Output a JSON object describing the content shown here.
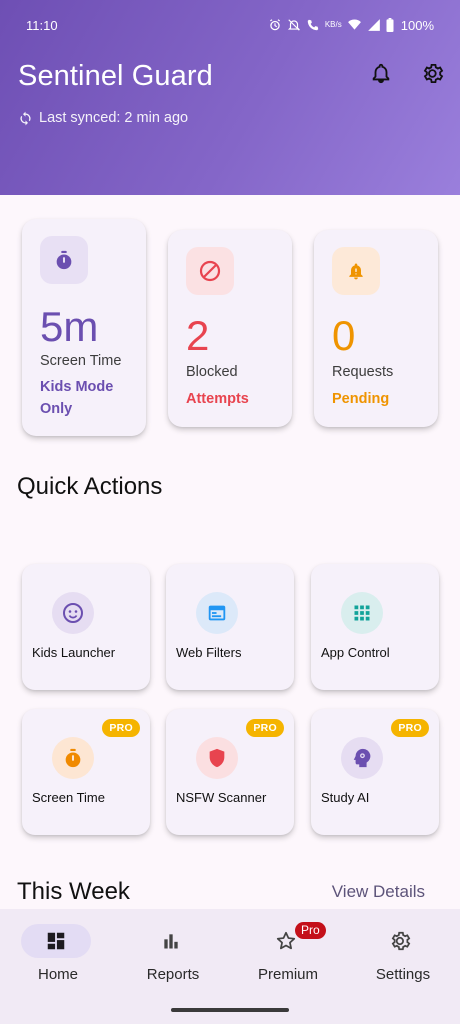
{
  "status_bar": {
    "time": "11:10",
    "battery": "100%"
  },
  "header": {
    "title": "Sentinel Guard",
    "sync_text": "Last synced: 2 min ago"
  },
  "stats": [
    {
      "value": "5m",
      "label": "Screen Time",
      "sub": "Kids Mode Only",
      "icon": "timer-icon",
      "color": "#6b4fb0",
      "icon_bg": "#e8e0f4"
    },
    {
      "value": "2",
      "label": "Blocked",
      "sub": "Attempts",
      "icon": "block-icon",
      "color": "#e8444f",
      "icon_bg": "#fbe1e3"
    },
    {
      "value": "0",
      "label": "Requests",
      "sub": "Pending",
      "icon": "alarm-bell-icon",
      "color": "#ef9400",
      "icon_bg": "#fde9d8"
    }
  ],
  "quick_actions": {
    "title": "Quick Actions",
    "items": [
      {
        "label": "Kids Launcher",
        "icon": "child-face-icon",
        "pro": false,
        "color": "#6b4fb0",
        "icon_bg": "#e6ddf2"
      },
      {
        "label": "Web Filters",
        "icon": "browser-window-icon",
        "pro": false,
        "color": "#2196f3",
        "icon_bg": "#dce9f9"
      },
      {
        "label": "App Control",
        "icon": "apps-grid-icon",
        "pro": false,
        "color": "#12a39a",
        "icon_bg": "#d9eeee"
      },
      {
        "label": "Screen Time",
        "icon": "timer-icon",
        "pro": true,
        "color": "#f08a00",
        "icon_bg": "#fde6d3"
      },
      {
        "label": "NSFW Scanner",
        "icon": "shield-icon",
        "pro": true,
        "color": "#e8444f",
        "icon_bg": "#fbdfe1"
      },
      {
        "label": "Study AI",
        "icon": "brain-head-icon",
        "pro": true,
        "color": "#6b4fb0",
        "icon_bg": "#e6ddf2"
      }
    ],
    "pro_label": "PRO"
  },
  "this_week": {
    "title": "This Week",
    "link": "View Details"
  },
  "bottom_nav": [
    {
      "label": "Home",
      "icon": "dashboard-icon",
      "active": true
    },
    {
      "label": "Reports",
      "icon": "bar-chart-icon",
      "active": false
    },
    {
      "label": "Premium",
      "icon": "star-icon",
      "active": false,
      "badge": "Pro"
    },
    {
      "label": "Settings",
      "icon": "gear-icon",
      "active": false
    }
  ],
  "colors": {
    "header_start": "#6e4fb4",
    "header_end": "#9a7fdc",
    "background": "#fdf7fc",
    "card": "#f6f1fa",
    "nav_active": "#e3dcf4",
    "pro_badge": "#f5b400"
  }
}
